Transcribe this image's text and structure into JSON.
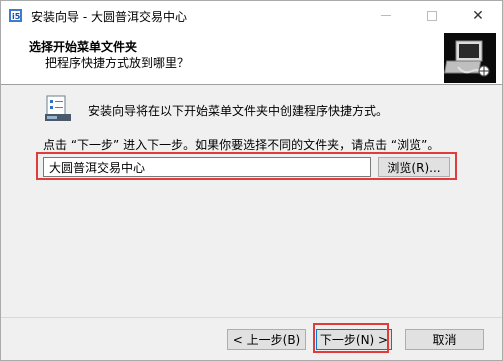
{
  "window": {
    "title": "安装向导 - 大圆普洱交易中心",
    "controls": {
      "minimize": "—",
      "maximize": "☐",
      "close": "✕"
    }
  },
  "header": {
    "title": "选择开始菜单文件夹",
    "subtitle": "把程序快捷方式放到哪里？"
  },
  "body": {
    "description": "安装向导将在以下开始菜单文件夹中创建程序快捷方式。",
    "instruction": "点击 “下一步” 进入下一步。如果你要选择不同的文件夹，请点击 “浏览”。",
    "folder_value": "大圆普洱交易中心",
    "browse_label": "浏览(R)..."
  },
  "footer": {
    "back_label": "< 上一步(B)",
    "next_label": "下一步(N) >",
    "cancel_label": "取消"
  },
  "colors": {
    "highlight": "#e03c3c",
    "focus_border": "#0078d7",
    "dialog_bg": "#f0f0f0"
  }
}
